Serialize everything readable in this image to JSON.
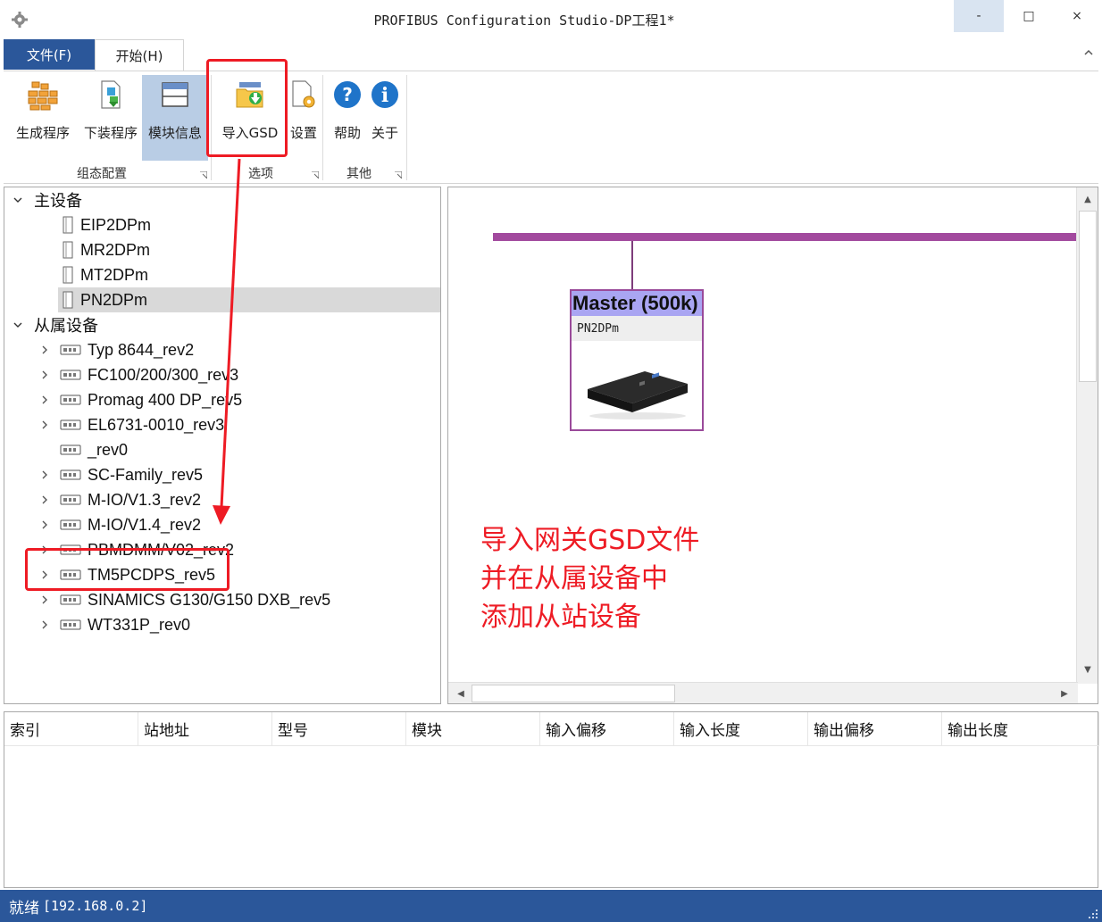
{
  "window": {
    "title": "PROFIBUS Configuration Studio-DP工程1*",
    "minimize": "-",
    "maximize": "□",
    "close": "×"
  },
  "ribbon": {
    "tabs": [
      {
        "label": "文件(F)"
      },
      {
        "label": "开始(H)"
      }
    ],
    "buttons": [
      {
        "label": "生成程序",
        "icon": "wall-bricks-icon"
      },
      {
        "label": "下装程序",
        "icon": "download-doc-icon"
      },
      {
        "label": "模块信息",
        "icon": "window-panel-icon"
      },
      {
        "label": "导入GSD",
        "icon": "folder-import-icon"
      },
      {
        "label": "设置",
        "icon": "settings-doc-icon"
      },
      {
        "label": "帮助",
        "icon": "help-icon"
      },
      {
        "label": "关于",
        "icon": "info-icon"
      }
    ],
    "groups": [
      {
        "label": "组态配置"
      },
      {
        "label": "选项"
      },
      {
        "label": "其他"
      }
    ]
  },
  "tree": {
    "master_root": "主设备",
    "masters": [
      "EIP2DPm",
      "MR2DPm",
      "MT2DPm",
      "PN2DPm"
    ],
    "selected_master": "PN2DPm",
    "slave_root": "从属设备",
    "slaves": [
      "Typ 8644_rev2",
      "FC100/200/300_rev3",
      "Promag 400 DP_rev5",
      "EL6731-0010_rev3",
      "_rev0",
      "SC-Family_rev5",
      "M-IO/V1.3_rev2",
      "M-IO/V1.4_rev2",
      "PBMDMM/V02_rev2",
      "TM5PCDPS_rev5",
      "SINAMICS G130/G150 DXB_rev5",
      "WT331P_rev0"
    ]
  },
  "canvas": {
    "master_title": "Master (500k)",
    "master_device": "PN2DPm",
    "bus_color": "#a24a9e",
    "annotation_lines": [
      "导入网关GSD文件",
      "并在从属设备中",
      "添加从站设备"
    ],
    "annotation_color": "#ee1b24"
  },
  "table": {
    "columns": [
      "索引",
      "站地址",
      "型号",
      "模块",
      "输入偏移",
      "输入长度",
      "输出偏移",
      "输出长度"
    ]
  },
  "status": {
    "text": "就绪",
    "address": "[192.168.0.2]"
  },
  "colors": {
    "accent": "#2b579a",
    "highlight": "#ee1b24",
    "active_button": "#b9cde5"
  }
}
